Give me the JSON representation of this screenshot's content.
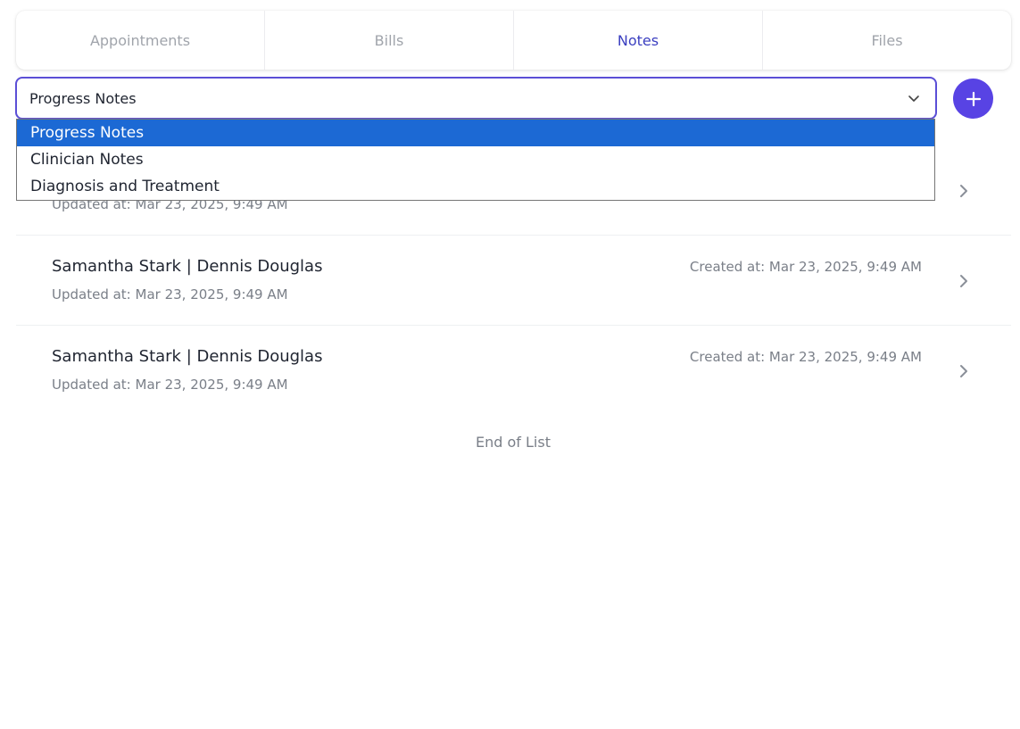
{
  "tabs": [
    {
      "label": "Appointments",
      "active": false
    },
    {
      "label": "Bills",
      "active": false
    },
    {
      "label": "Notes",
      "active": true
    },
    {
      "label": "Files",
      "active": false
    }
  ],
  "note_type_select": {
    "value": "Progress Notes",
    "options": [
      "Progress Notes",
      "Clinician Notes",
      "Diagnosis and Treatment"
    ],
    "selected_index": 0
  },
  "add_button": {
    "icon": "plus-icon"
  },
  "notes": [
    {
      "title": "",
      "updated": "Updated at: Mar 23, 2025, 9:49 AM",
      "created": ""
    },
    {
      "title": "Samantha Stark | Dennis Douglas",
      "updated": "Updated at: Mar 23, 2025, 9:49 AM",
      "created": "Created at: Mar 23, 2025, 9:49 AM"
    },
    {
      "title": "Samantha Stark | Dennis Douglas",
      "updated": "Updated at: Mar 23, 2025, 9:49 AM",
      "created": "Created at: Mar 23, 2025, 9:49 AM"
    }
  ],
  "end_of_list": "End of List",
  "colors": {
    "accent": "#5843e4",
    "active_tab": "#3b3fc0",
    "selected_option": "#1c69d4"
  }
}
